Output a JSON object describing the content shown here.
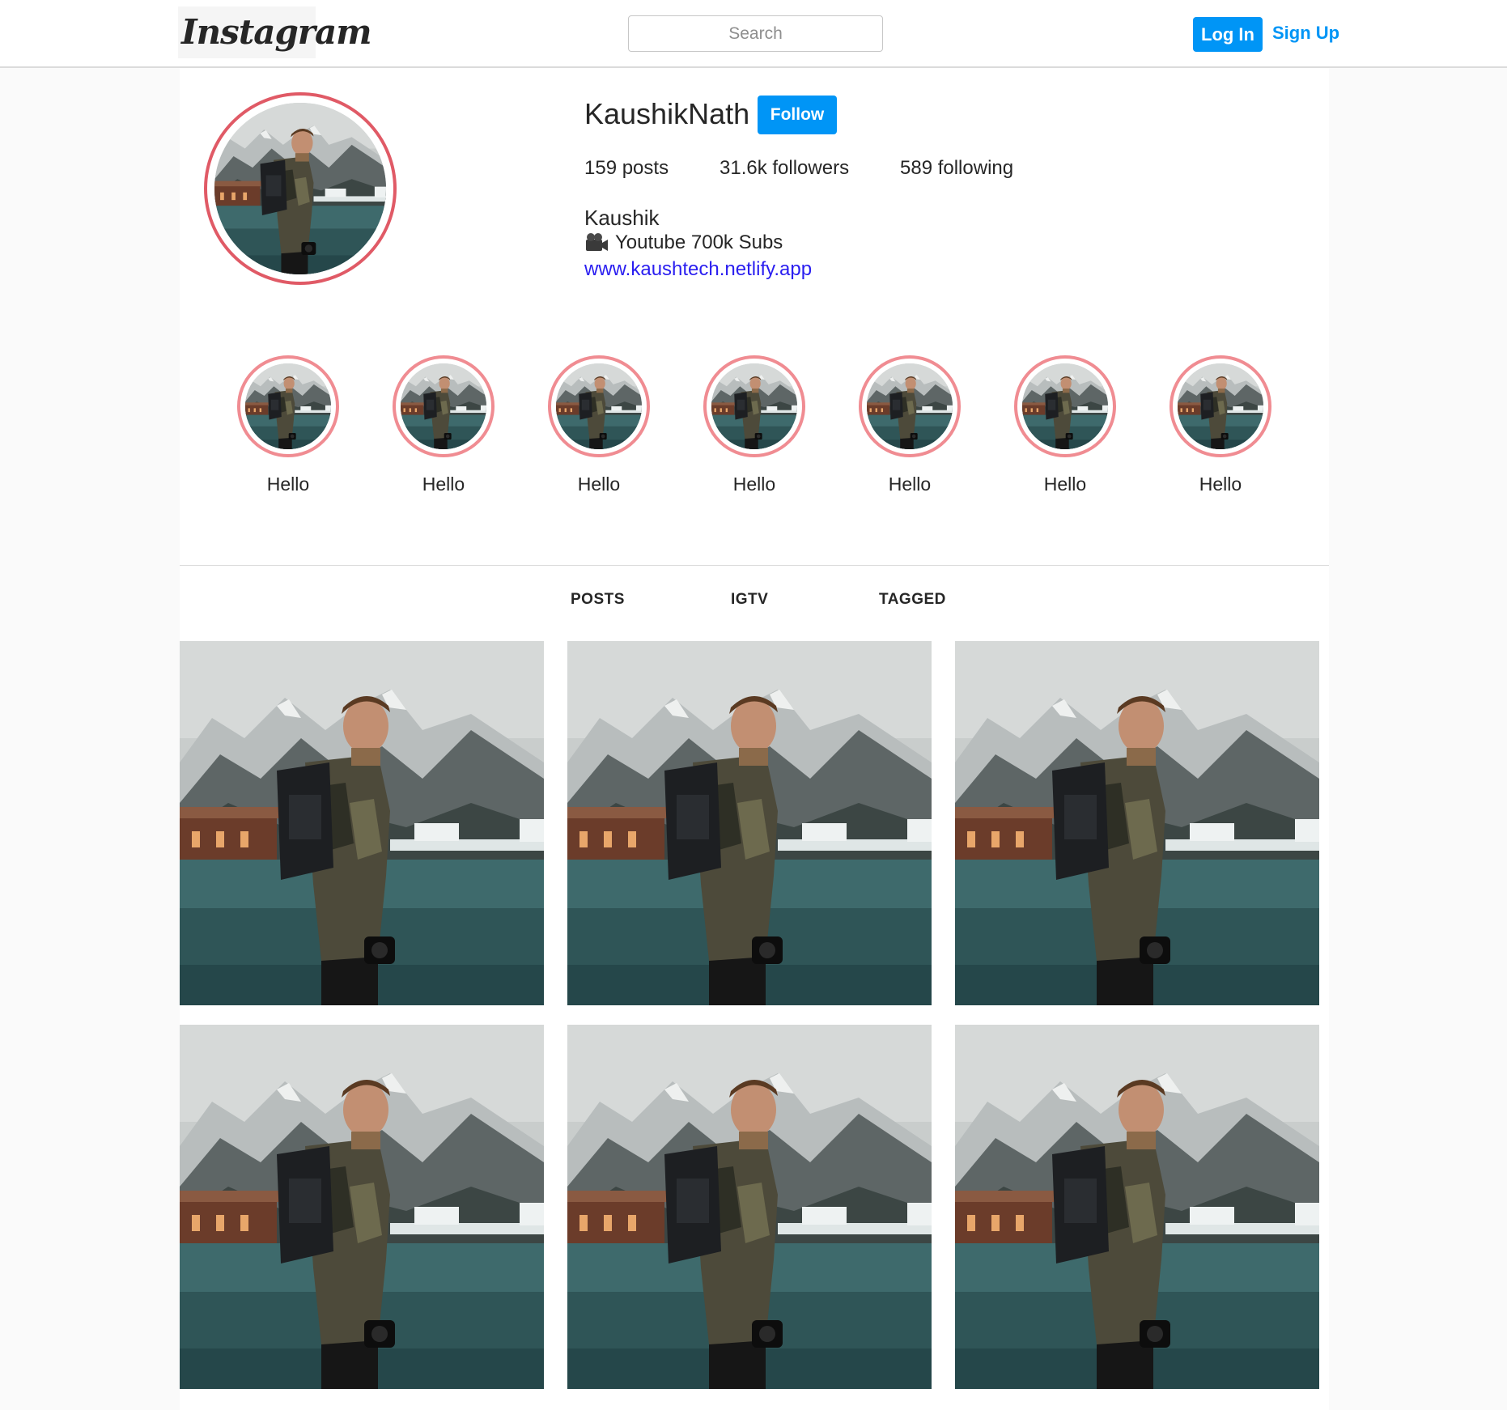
{
  "nav": {
    "logo_text": "Instagram",
    "search_placeholder": "Search",
    "login_label": "Log In",
    "signup_label": "Sign Up"
  },
  "profile": {
    "username": "KaushikNath",
    "follow_label": "Follow",
    "stats": {
      "posts": "159 posts",
      "followers": "31.6k followers",
      "following": "589 following"
    },
    "full_name": "Kaushik",
    "bio": "Youtube 700k Subs",
    "bio_icon": "video-camera-icon",
    "website": "www.kaushtech.netlify.app"
  },
  "highlights": [
    {
      "label": "Hello"
    },
    {
      "label": "Hello"
    },
    {
      "label": "Hello"
    },
    {
      "label": "Hello"
    },
    {
      "label": "Hello"
    },
    {
      "label": "Hello"
    },
    {
      "label": "Hello"
    }
  ],
  "tabs": [
    {
      "label": "POSTS"
    },
    {
      "label": "IGTV"
    },
    {
      "label": "TAGGED"
    }
  ],
  "colors": {
    "accent": "#0095f6",
    "story_ring": "#e05a66",
    "link": "#2a1ef0"
  }
}
